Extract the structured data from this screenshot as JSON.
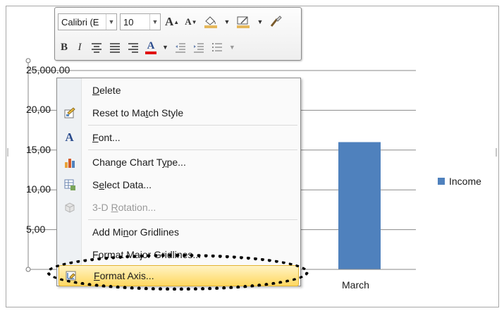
{
  "colors": {
    "bar": "#4f81bd",
    "gridline": "#8a8a8a",
    "axis": "#8a8a8a"
  },
  "chart_data": {
    "type": "bar",
    "categories": [
      "March"
    ],
    "series": [
      {
        "name": "Income",
        "values": [
          16000
        ],
        "color": "#4f81bd"
      }
    ],
    "ylim": [
      0,
      25000
    ],
    "y_ticks": [
      5000,
      10000,
      15000,
      20000,
      25000
    ],
    "y_tick_labels": [
      "5,00",
      "10,00",
      "15,00",
      "20,00",
      "25,000.00"
    ],
    "grid": true,
    "legend_position": "right",
    "title": "",
    "xlabel": "",
    "ylabel": ""
  },
  "mini_toolbar": {
    "font_name": "Calibri (E",
    "font_size": "10",
    "grow_font_icon": "grow-font-icon",
    "shrink_font_icon": "shrink-font-icon",
    "fill_color_icon": "fill-color-icon",
    "line_color_icon": "line-color-icon",
    "format_painter_icon": "format-painter-icon",
    "bold_label": "B",
    "italic_label": "I",
    "font_color_label": "A"
  },
  "context_menu": {
    "items": [
      {
        "label_pre": "",
        "key": "D",
        "label_post": "elete",
        "icon": "none",
        "disabled": false
      },
      {
        "label_pre": "Reset to Ma",
        "key": "t",
        "label_post": "ch Style",
        "icon": "reset-style-icon",
        "disabled": false
      },
      {
        "label_pre": "",
        "key": "F",
        "label_post": "ont...",
        "icon": "font-icon",
        "disabled": false
      },
      {
        "label_pre": "Change Chart T",
        "key": "y",
        "label_post": "pe...",
        "icon": "chart-type-icon",
        "disabled": false
      },
      {
        "label_pre": "S",
        "key": "e",
        "label_post": "lect Data...",
        "icon": "select-data-icon",
        "disabled": false
      },
      {
        "label_pre": "3-D ",
        "key": "R",
        "label_post": "otation...",
        "icon": "rotation-3d-icon",
        "disabled": true
      },
      {
        "label_pre": "Add Mi",
        "key": "n",
        "label_post": "or Gridlines",
        "icon": "none",
        "disabled": false
      },
      {
        "label_pre": "Format Ma",
        "key": "j",
        "label_post": "or Gridlines...",
        "icon": "none",
        "disabled": false
      },
      {
        "label_pre": "",
        "key": "F",
        "label_post": "ormat Axis...",
        "icon": "format-axis-icon",
        "disabled": false
      }
    ]
  }
}
